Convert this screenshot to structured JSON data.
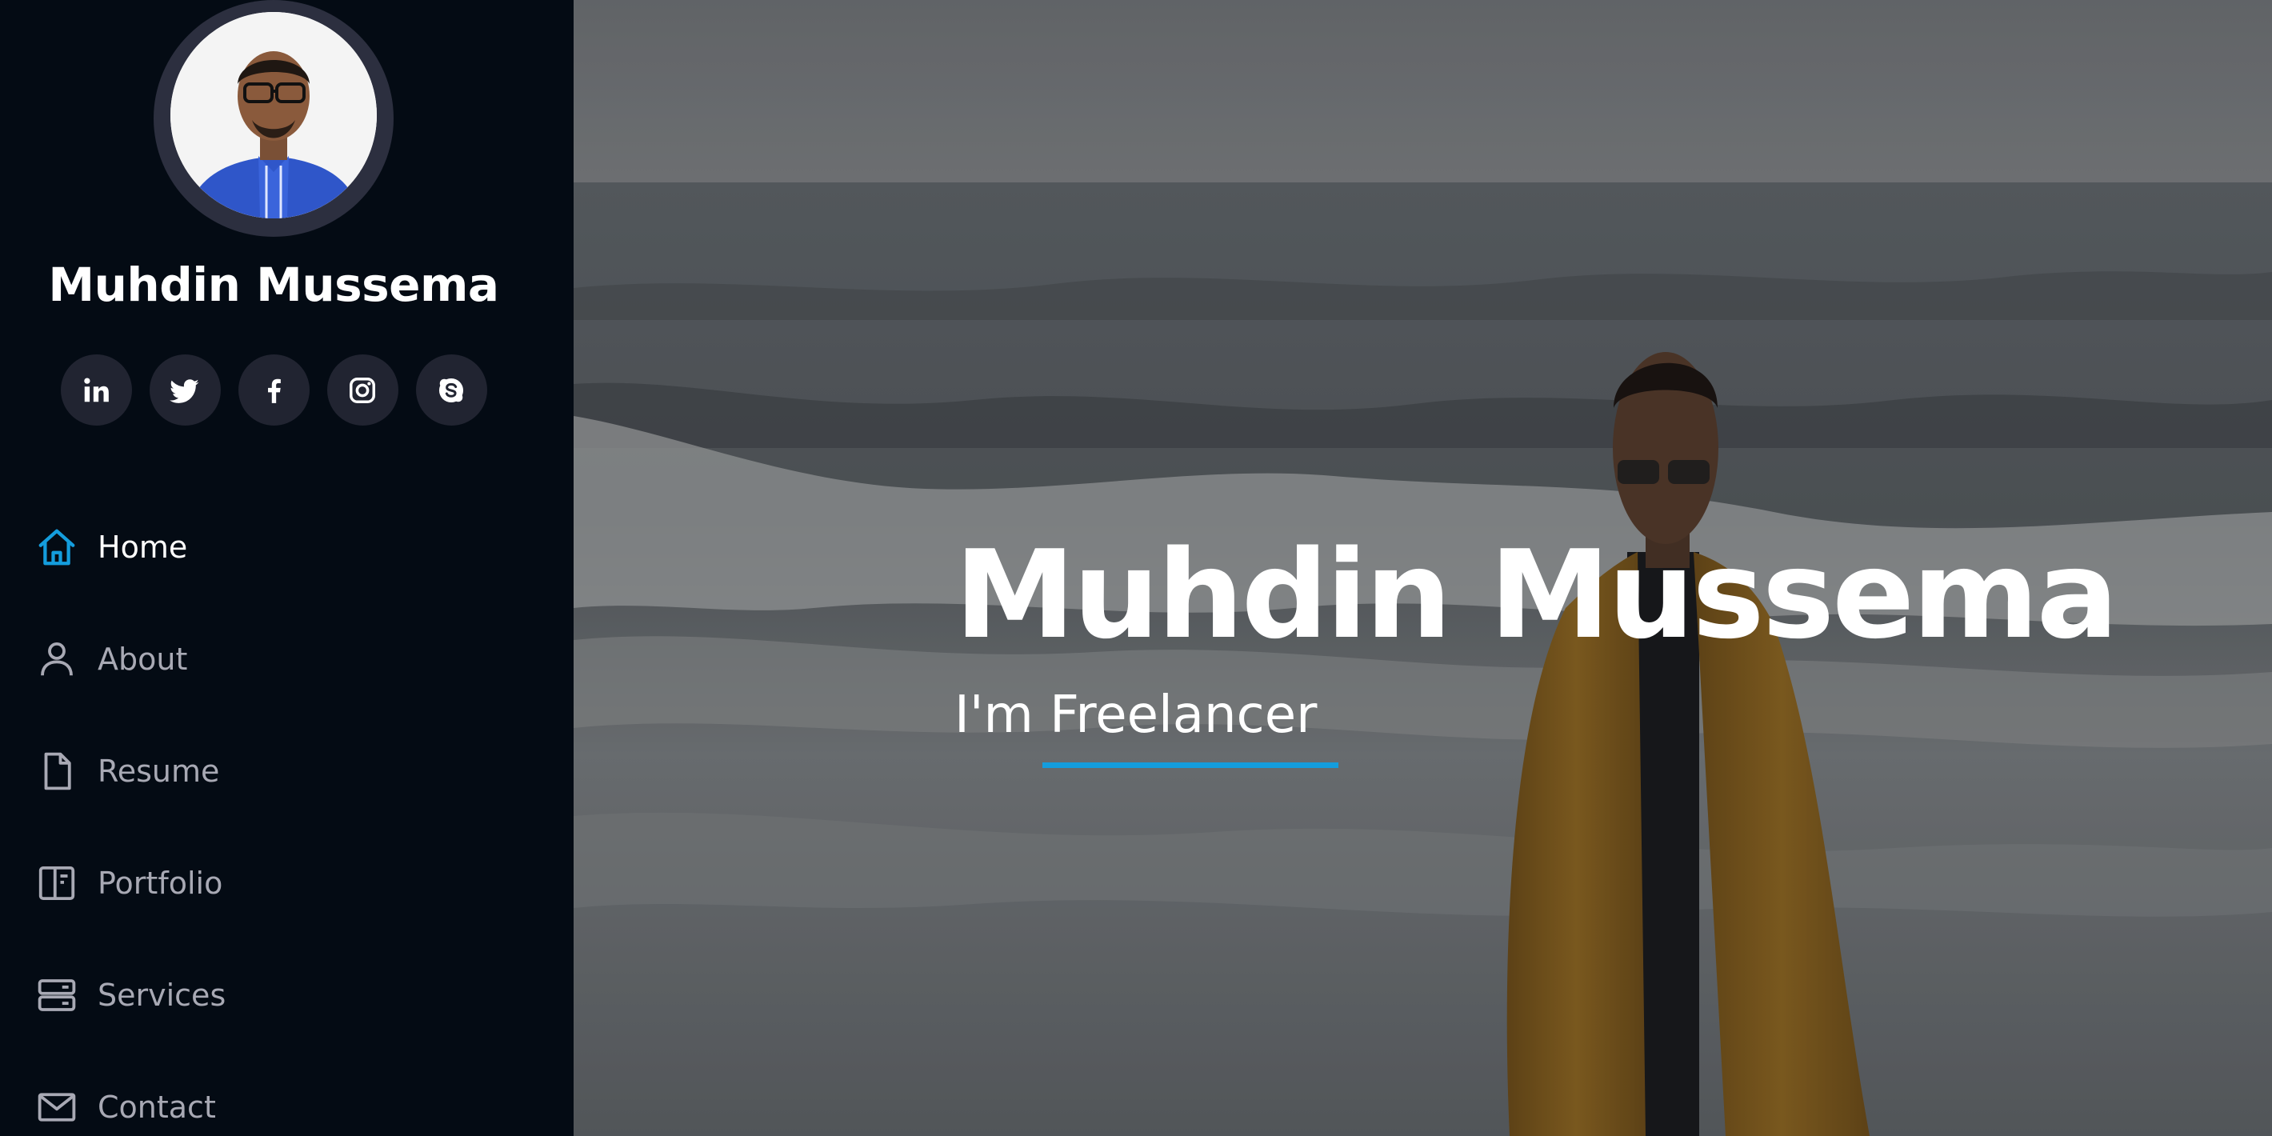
{
  "sidebar": {
    "profile_name": "Muhdin Mussema",
    "social": [
      {
        "icon": "linkedin-icon"
      },
      {
        "icon": "twitter-icon"
      },
      {
        "icon": "facebook-icon"
      },
      {
        "icon": "instagram-icon"
      },
      {
        "icon": "skype-icon"
      }
    ],
    "nav": {
      "items": [
        {
          "label": "Home",
          "icon": "home-icon",
          "active": true
        },
        {
          "label": "About",
          "icon": "person-icon",
          "active": false
        },
        {
          "label": "Resume",
          "icon": "file-icon",
          "active": false
        },
        {
          "label": "Portfolio",
          "icon": "book-icon",
          "active": false
        },
        {
          "label": "Services",
          "icon": "server-icon",
          "active": false
        },
        {
          "label": "Contact",
          "icon": "envelope-icon",
          "active": false
        }
      ]
    }
  },
  "hero": {
    "title": "Muhdin Mussema",
    "subtitle": "I'm Freelancer"
  },
  "colors": {
    "accent": "#149ddd",
    "sidebar_bg": "#040b14",
    "social_bg": "#212431",
    "nav_text": "#a8a9b4"
  }
}
